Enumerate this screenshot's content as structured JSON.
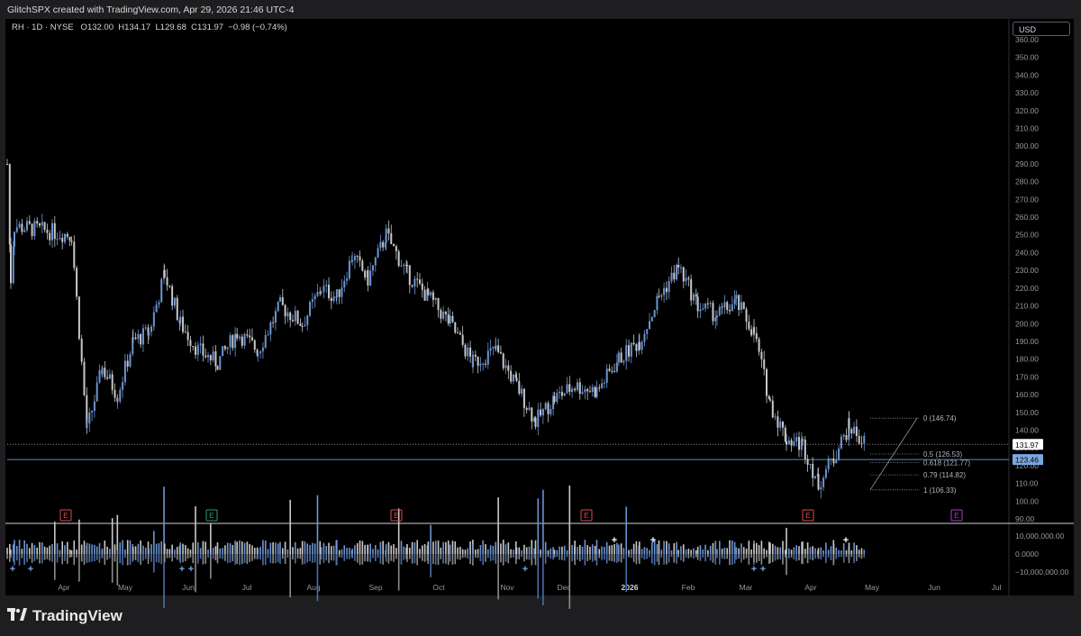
{
  "header": {
    "text": "GlitchSPX created with TradingView.com, Apr 29, 2026 21:46 UTC-4"
  },
  "legend": {
    "symbol": "RH · 1D · NYSE",
    "o_label": "O",
    "o": "132.00",
    "h_label": "H",
    "h": "134.17",
    "l_label": "L",
    "l": "129.68",
    "c_label": "C",
    "c": "131.97",
    "change": "−0.98 (−0.74%)"
  },
  "currency_button": "USD",
  "brand": "TradingView",
  "colors": {
    "bull": "#6d95d2",
    "bear": "#c8c8c8",
    "hline": "#5b8cc8",
    "price_tag": "#ffffff",
    "earnings_red": "#e5484d",
    "earnings_green": "#2a9d76",
    "earnings_purple": "#b23acd"
  },
  "chart_data": {
    "type": "candlestick",
    "y_axis_ticks": [
      "360.00",
      "350.00",
      "340.00",
      "330.00",
      "320.00",
      "310.00",
      "300.00",
      "290.00",
      "280.00",
      "270.00",
      "260.00",
      "250.00",
      "240.00",
      "230.00",
      "220.00",
      "210.00",
      "200.00",
      "190.00",
      "180.00",
      "170.00",
      "160.00",
      "150.00",
      "140.00",
      "130.00",
      "120.00",
      "110.00",
      "100.00",
      "90.00"
    ],
    "ylim": [
      90,
      360
    ],
    "x_axis_ticks": [
      "Apr",
      "May",
      "Jun",
      "Jul",
      "Aug",
      "Sep",
      "Oct",
      "Nov",
      "Dec",
      "2026",
      "Feb",
      "Mar",
      "Apr",
      "May",
      "Jun",
      "Jul"
    ],
    "last_price": 131.97,
    "last_price_label": "131.97",
    "horizontal_line": 123.46,
    "horizontal_line_label": "123.46",
    "fib_levels": [
      {
        "ratio": "0",
        "value": 146.74,
        "label": "0 (146.74)"
      },
      {
        "ratio": "0.5",
        "value": 126.53,
        "label": "0.5 (126.53)"
      },
      {
        "ratio": "0.618",
        "value": 121.77,
        "label": "0.618 (121.77)"
      },
      {
        "ratio": "0.79",
        "value": 114.82,
        "label": "0.79 (114.82)"
      },
      {
        "ratio": "1",
        "value": 106.33,
        "label": "1 (106.33)"
      }
    ],
    "earnings_markers": [
      {
        "month": "Apr 2025",
        "label": "E",
        "color": "red"
      },
      {
        "month": "Jun 2025",
        "label": "E",
        "color": "green"
      },
      {
        "month": "Sep 2025",
        "label": "E",
        "color": "red"
      },
      {
        "month": "Dec 2025",
        "label": "E",
        "color": "red"
      },
      {
        "month": "Apr 2026",
        "label": "E",
        "color": "red"
      },
      {
        "month": "Jun 2026",
        "label": "E",
        "color": "purple"
      }
    ],
    "candle_path": [
      [
        "Mar 2025",
        290
      ],
      [
        "Mar 2025",
        225
      ],
      [
        "Mar 2025",
        255
      ],
      [
        "Apr 2025",
        250
      ],
      [
        "Apr 2025",
        140
      ],
      [
        "Apr 2025",
        175
      ],
      [
        "Apr 2025",
        160
      ],
      [
        "May 2025",
        190
      ],
      [
        "May 2025",
        195
      ],
      [
        "May 2025",
        228
      ],
      [
        "May 2025",
        200
      ],
      [
        "Jun 2025",
        185
      ],
      [
        "Jun 2025",
        178
      ],
      [
        "Jun 2025",
        195
      ],
      [
        "Jul 2025",
        185
      ],
      [
        "Jul 2025",
        210
      ],
      [
        "Jul 2025",
        200
      ],
      [
        "Aug 2025",
        220
      ],
      [
        "Aug 2025",
        215
      ],
      [
        "Aug 2025",
        238
      ],
      [
        "Aug 2025",
        225
      ],
      [
        "Sep 2025",
        250
      ],
      [
        "Sep 2025",
        228
      ],
      [
        "Sep 2025",
        215
      ],
      [
        "Oct 2025",
        200
      ],
      [
        "Oct 2025",
        178
      ],
      [
        "Oct 2025",
        185
      ],
      [
        "Nov 2025",
        165
      ],
      [
        "Nov 2025",
        145
      ],
      [
        "Nov 2025",
        158
      ],
      [
        "Dec 2025",
        165
      ],
      [
        "Dec 2025",
        162
      ],
      [
        "Dec 2025",
        180
      ],
      [
        "Jan 2026",
        190
      ],
      [
        "Jan 2026",
        215
      ],
      [
        "Jan 2026",
        232
      ],
      [
        "Feb 2026",
        210
      ],
      [
        "Feb 2026",
        205
      ],
      [
        "Feb 2026",
        212
      ],
      [
        "Mar 2026",
        195
      ],
      [
        "Mar 2026",
        155
      ],
      [
        "Mar 2026",
        135
      ],
      [
        "Mar 2026",
        132
      ],
      [
        "Apr 2026",
        110
      ],
      [
        "Apr 2026",
        125
      ],
      [
        "Apr 2026",
        142
      ],
      [
        "Apr 2026",
        133
      ]
    ],
    "volume_axis_ticks": [
      "10,000,000.00",
      "0.0000",
      "−10,000,000.00"
    ],
    "volume_ylim": [
      -15000000,
      15000000
    ],
    "volume_signal_markers": [
      {
        "month": "Mar 2025",
        "label": "+",
        "side": "below"
      },
      {
        "month": "Mar 2025",
        "label": "+",
        "side": "below"
      },
      {
        "month": "Jun 2025",
        "label": "+",
        "side": "below"
      },
      {
        "month": "Jun 2025",
        "label": "+",
        "side": "below"
      },
      {
        "month": "Nov 2025",
        "label": "+",
        "side": "below"
      },
      {
        "month": "Dec 2025",
        "label": "+",
        "side": "above"
      },
      {
        "month": "Jan 2026",
        "label": "+",
        "side": "above"
      },
      {
        "month": "Mar 2026",
        "label": "+",
        "side": "below"
      },
      {
        "month": "Mar 2026",
        "label": "+",
        "side": "below"
      },
      {
        "month": "Apr 2026",
        "label": "+",
        "side": "above"
      }
    ]
  }
}
